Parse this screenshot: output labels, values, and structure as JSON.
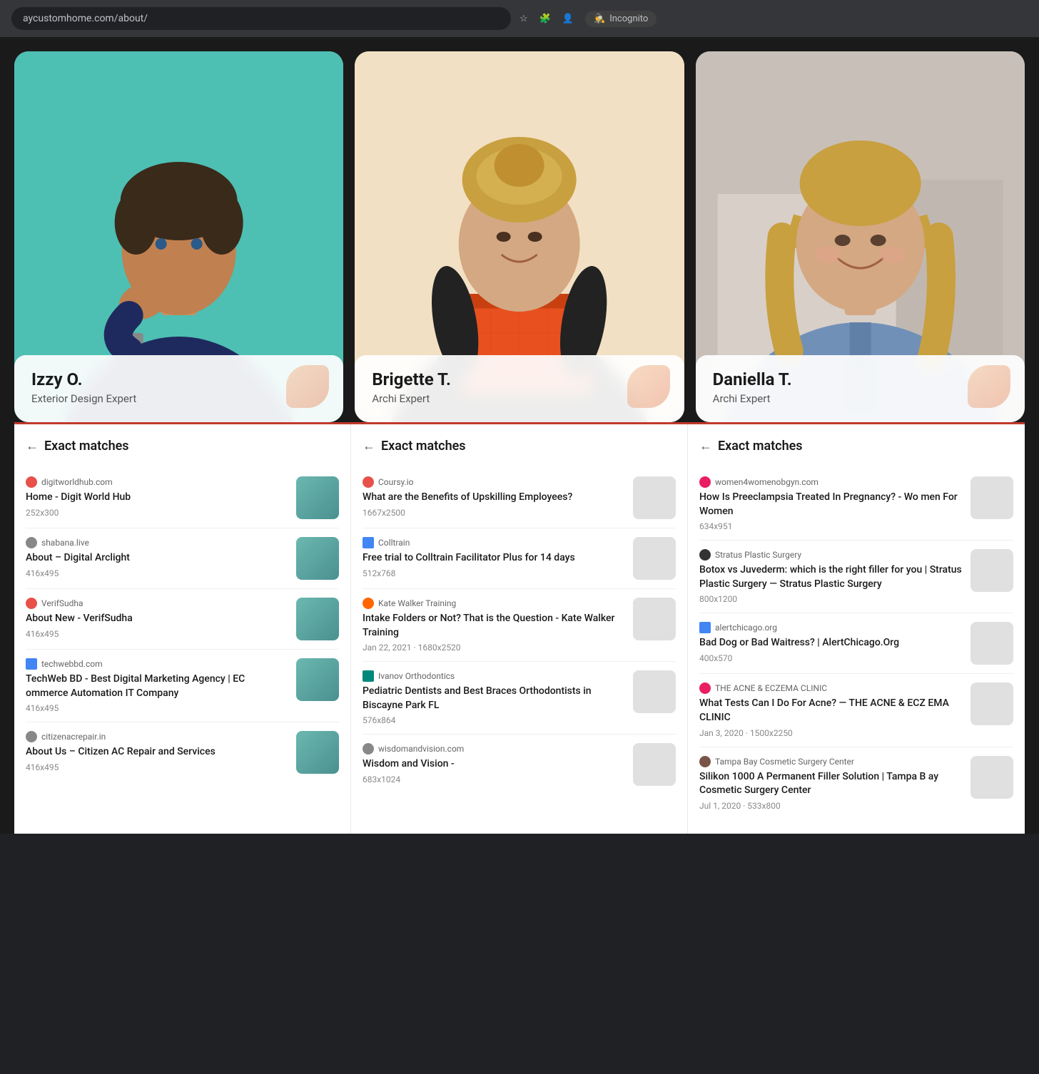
{
  "browser": {
    "url": "aycustomhome.com/about/",
    "incognito_label": "Incognito"
  },
  "profiles": [
    {
      "id": "izzy",
      "name": "Izzy O.",
      "role": "Exterior Design Expert",
      "bg_color": "#4ebfb3"
    },
    {
      "id": "brigette",
      "name": "Brigette T.",
      "role": "Archi Expert",
      "bg_color": "#f2e0c4"
    },
    {
      "id": "daniella",
      "name": "Daniella T.",
      "role": "Archi Expert",
      "bg_color": "#c8c0b8"
    }
  ],
  "columns": [
    {
      "id": "col1",
      "header": "Exact matches",
      "results": [
        {
          "source_domain": "digitworldhub.com",
          "favicon_class": "favicon-red",
          "title": "Home - Digit World Hub",
          "meta": "252x300",
          "has_thumb": true,
          "thumb_class": "thumb-img"
        },
        {
          "source_domain": "shabana.live",
          "favicon_class": "favicon-gray",
          "title": "About – Digital Arclight",
          "meta": "416x495",
          "has_thumb": true,
          "thumb_class": "thumb-img"
        },
        {
          "source_domain": "VerifSudha",
          "favicon_class": "favicon-red",
          "title": "About New - VerifSudha",
          "meta": "416x495",
          "has_thumb": true,
          "thumb_class": "thumb-img"
        },
        {
          "source_domain": "techwebbd.com",
          "favicon_class": "favicon-blue",
          "title": "TechWeb BD - Best Digital Marketing Agency | EC ommerce Automation IT Company",
          "meta": "416x495",
          "has_thumb": true,
          "thumb_class": "thumb-img"
        },
        {
          "source_domain": "citizenacrepair.in",
          "favicon_class": "favicon-gray",
          "title": "About Us – Citizen AC Repair and Services",
          "meta": "416x495",
          "has_thumb": true,
          "thumb_class": "thumb-img"
        }
      ]
    },
    {
      "id": "col2",
      "header": "Exact matches",
      "results": [
        {
          "source_domain": "Coursy.io",
          "favicon_class": "favicon-red",
          "title": "What are the Benefits of Upskilling Employees?",
          "meta": "1667x2500",
          "has_thumb": true,
          "thumb_class": "thumb-img-2"
        },
        {
          "source_domain": "Colltrain",
          "favicon_class": "favicon-blue",
          "title": "Free trial to Colltrain Facilitator Plus for 14 days",
          "meta": "512x768",
          "has_thumb": true,
          "thumb_class": "thumb-img-2"
        },
        {
          "source_domain": "Kate Walker Training",
          "favicon_class": "favicon-orange",
          "title": "Intake Folders or Not? That is the Question - Kate Walker Training",
          "meta": "Jan 22, 2021 · 1680x2520",
          "has_thumb": true,
          "thumb_class": "thumb-img-2"
        },
        {
          "source_domain": "Ivanov Orthodontics",
          "favicon_class": "favicon-teal",
          "title": "Pediatric Dentists and Best Braces Orthodontists in Biscayne Park FL",
          "meta": "576x864",
          "has_thumb": true,
          "thumb_class": "thumb-img-2"
        },
        {
          "source_domain": "wisdomandvision.com",
          "favicon_class": "favicon-gray",
          "title": "Wisdom and Vision -",
          "meta": "683x1024",
          "has_thumb": true,
          "thumb_class": "thumb-img-2"
        }
      ]
    },
    {
      "id": "col3",
      "header": "Exact matches",
      "results": [
        {
          "source_domain": "women4womenobgyn.com",
          "favicon_class": "favicon-pink",
          "title": "How Is Preeclampsia Treated In Pregnancy? - Wo men For Women",
          "meta": "634x951",
          "has_thumb": true,
          "thumb_class": "thumb-img-3"
        },
        {
          "source_domain": "Stratus Plastic Surgery",
          "favicon_class": "favicon-dark",
          "title": "Botox vs Juvederm: which is the right filler for you | Stratus Plastic Surgery — Stratus Plastic Surgery",
          "meta": "800x1200",
          "has_thumb": true,
          "thumb_class": "thumb-img-3"
        },
        {
          "source_domain": "alertchicago.org",
          "favicon_class": "favicon-blue",
          "title": "Bad Dog or Bad Waitress? | AlertChicago.Org",
          "meta": "400x570",
          "has_thumb": true,
          "thumb_class": "thumb-img-3"
        },
        {
          "source_domain": "THE ACNE & ECZEMA CLINIC",
          "favicon_class": "favicon-pink",
          "title": "What Tests Can I Do For Acne? — THE ACNE & ECZ EMA CLINIC",
          "meta": "Jan 3, 2020 · 1500x2250",
          "has_thumb": true,
          "thumb_class": "thumb-img-3"
        },
        {
          "source_domain": "Tampa Bay Cosmetic Surgery Center",
          "favicon_class": "favicon-brown",
          "title": "Silikon 1000 A Permanent Filler Solution | Tampa B ay Cosmetic Surgery Center",
          "meta": "Jul 1, 2020 · 533x800",
          "has_thumb": true,
          "thumb_class": "thumb-img-3"
        }
      ]
    }
  ]
}
